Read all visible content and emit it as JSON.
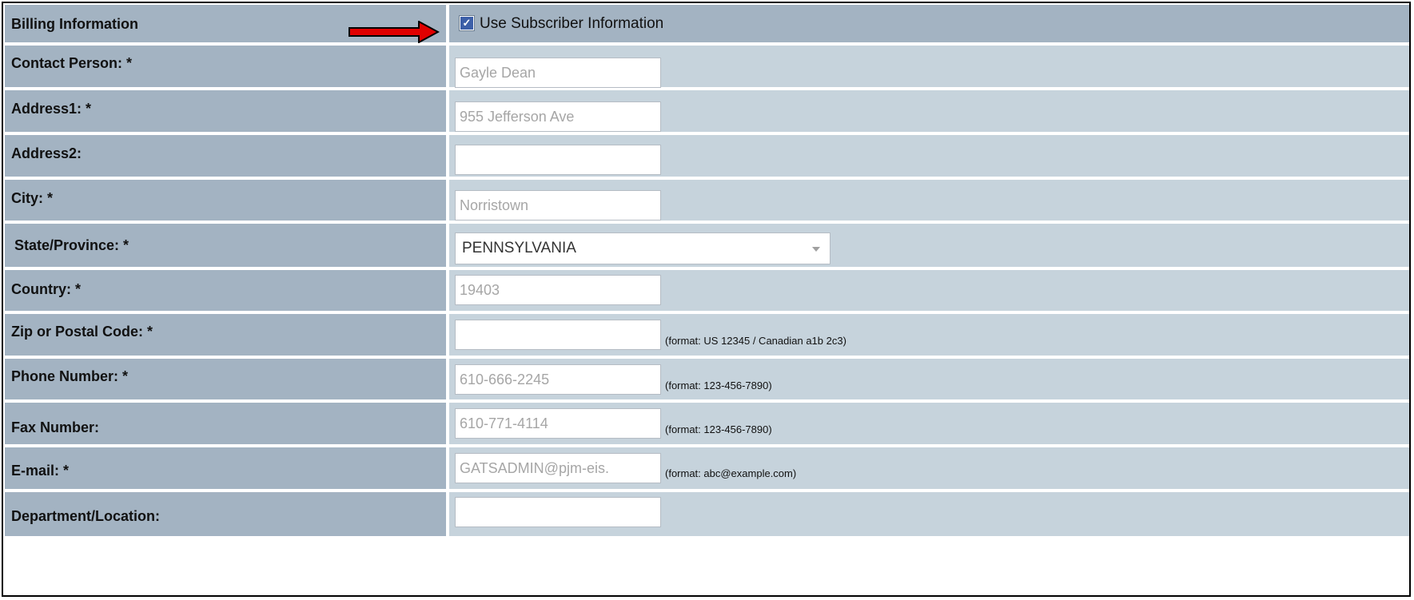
{
  "billing": {
    "header_label": "Billing Information",
    "use_subscriber_label": "Use Subscriber Information",
    "use_subscriber_checked": true
  },
  "fields": {
    "contact_person": {
      "label": "Contact Person: *",
      "value": "Gayle Dean"
    },
    "address1": {
      "label": "Address1: *",
      "value": "955 Jefferson Ave"
    },
    "address2": {
      "label": "Address2:",
      "value": ""
    },
    "city": {
      "label": "City: *",
      "value": "Norristown"
    },
    "state": {
      "label": "State/Province: *",
      "value": "PENNSYLVANIA"
    },
    "country": {
      "label": "Country: *",
      "value": "19403"
    },
    "zip": {
      "label": "Zip or Postal Code: *",
      "value": "",
      "hint": "(format: US 12345 / Canadian a1b 2c3)"
    },
    "phone": {
      "label": "Phone Number: *",
      "value": "610-666-2245",
      "hint": "(format: 123-456-7890)"
    },
    "fax": {
      "label": "Fax Number:",
      "value": "610-771-4114",
      "hint": "(format: 123-456-7890)"
    },
    "email": {
      "label": "E-mail: *",
      "value": "GATSADMIN@pjm-eis.",
      "hint": "(format: abc@example.com)"
    },
    "department": {
      "label": "Department/Location:",
      "value": ""
    }
  },
  "colors": {
    "label_bg": "#a3b3c2",
    "value_bg": "#c6d3dc",
    "arrow": "#e00000",
    "checkbox": "#3c5fa8"
  },
  "icons": {
    "arrow": "right-arrow-icon",
    "checkbox": "checkbox-checked-icon",
    "select_caret": "chevron-down-icon"
  }
}
